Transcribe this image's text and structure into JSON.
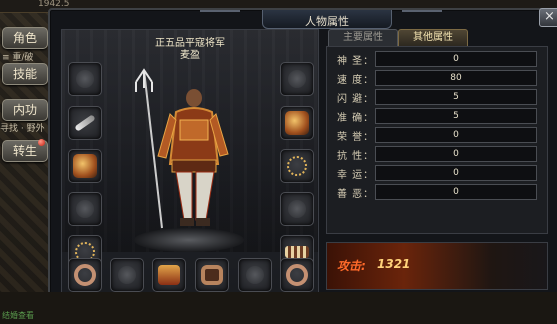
{
  "window": {
    "title": "人物属性",
    "close_glyph": "×"
  },
  "side": {
    "top_text": "1942.5",
    "buttons": [
      {
        "label": "角色"
      },
      {
        "label": "技能"
      },
      {
        "label": "内功"
      },
      {
        "label": "转生"
      }
    ],
    "frag1": "≡ 重/破",
    "frag2": "寻找 · 野外",
    "bottom_text": "结婚查看"
  },
  "character": {
    "rank_title": "正五品平寇将军",
    "name": "麦盈"
  },
  "tabs": [
    {
      "label": "主要属性",
      "active": false
    },
    {
      "label": "其他属性",
      "active": true
    }
  ],
  "stats": [
    {
      "label": "神 圣：",
      "value": "0"
    },
    {
      "label": "速 度：",
      "value": "80"
    },
    {
      "label": "闪 避：",
      "value": "5"
    },
    {
      "label": "准 确：",
      "value": "5"
    },
    {
      "label": "荣 誉：",
      "value": "0"
    },
    {
      "label": "抗 性：",
      "value": "0"
    },
    {
      "label": "幸 运：",
      "value": "0"
    },
    {
      "label": "善 恶：",
      "value": "0"
    }
  ],
  "power": {
    "label": "攻击:",
    "value": "1321"
  },
  "equipment": {
    "left": [
      "helmet-empty",
      "trident-weapon",
      "gold-armlet",
      "bracelet-empty",
      "bead-bracelet"
    ],
    "right": [
      "helmet-empty",
      "gold-medal",
      "necklace",
      "bracelet-empty",
      "pearl-bracelet"
    ],
    "bottom": [
      "ring-bronze",
      "ring-empty",
      "gold-boots",
      "jeweled-ring",
      "ring-empty",
      "ring-bronze"
    ]
  },
  "colors": {
    "accent": "#ff6a2a",
    "power_value": "#ffd27a"
  }
}
